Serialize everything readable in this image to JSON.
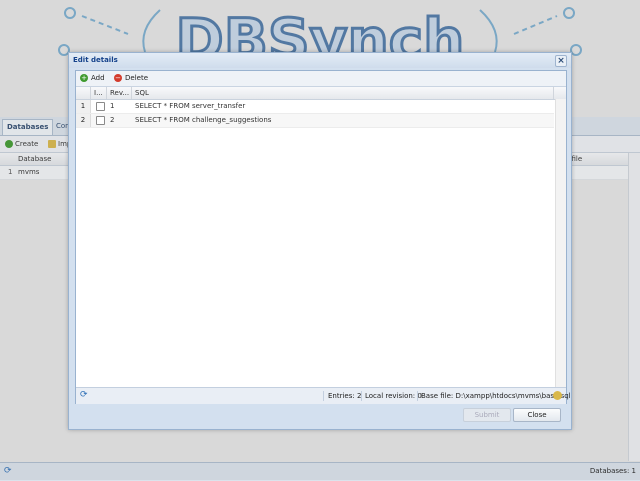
{
  "app": {
    "logo_text": "DBSynch",
    "tabs": [
      "Databases",
      "Con"
    ],
    "toolbar": {
      "create": "Create",
      "import": "Imp"
    },
    "grid": {
      "columns": {
        "database": "Database",
        "local_file": "al file"
      },
      "rows": [
        {
          "num": "1",
          "database": "mvms",
          "local_file": "sl"
        }
      ]
    },
    "status": {
      "databases": "Databases: 1"
    }
  },
  "dialog": {
    "title": "Edit details",
    "toolbar": {
      "add": "Add",
      "delete": "Delete"
    },
    "columns": {
      "id": "I...",
      "revision": "Rev...",
      "sql": "SQL"
    },
    "rows": [
      {
        "num": "1",
        "revision": "1",
        "sql": "SELECT * FROM server_transfer"
      },
      {
        "num": "2",
        "revision": "2",
        "sql": "SELECT * FROM challenge_suggestions"
      }
    ],
    "status": {
      "entries": "Entries: 2",
      "local_revision": "Local revision: 0",
      "base_file": "Base file: D:\\xampp\\htdocs\\mvms\\base.sql"
    },
    "buttons": {
      "submit": "Submit",
      "close": "Close"
    }
  },
  "colors": {
    "accent": "#15428b",
    "header_bg": "#d3e0ef",
    "add_icon": "#3f9a2f",
    "delete_icon": "#d33b2c"
  }
}
